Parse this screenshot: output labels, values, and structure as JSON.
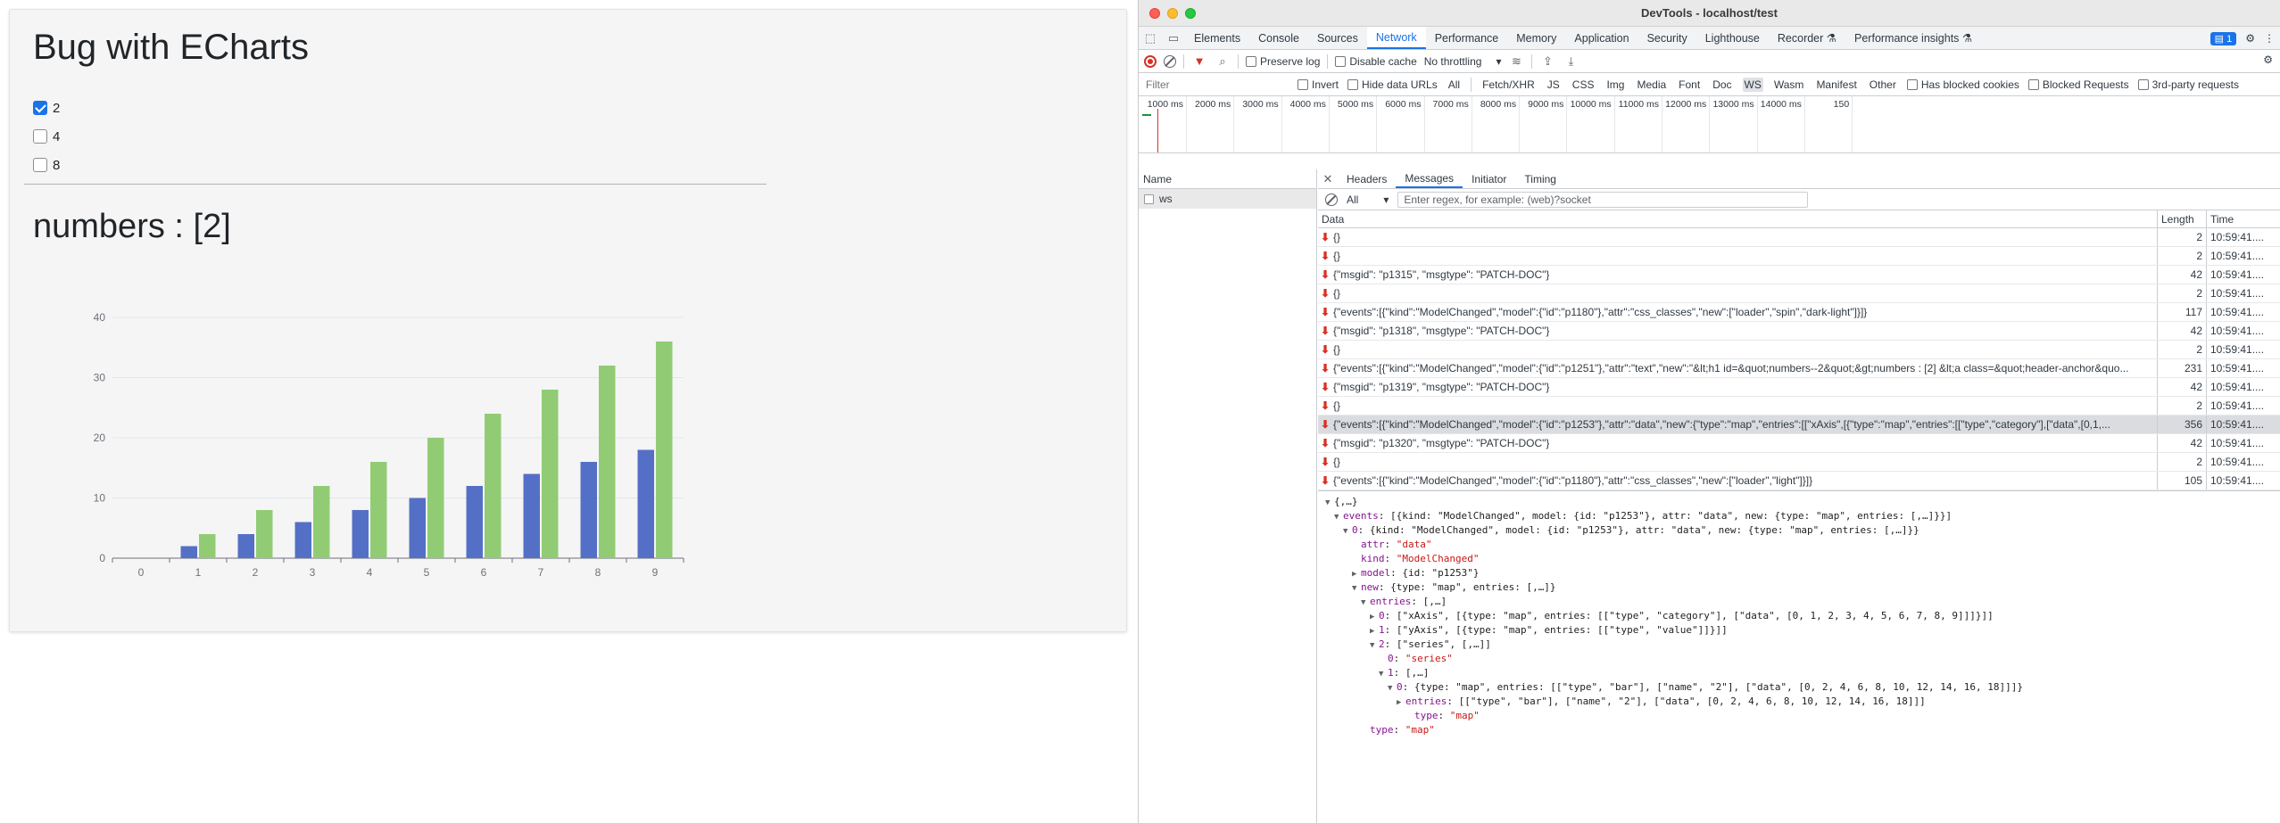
{
  "app": {
    "title": "Bug with ECharts",
    "checkboxes": [
      {
        "label": "2",
        "checked": true
      },
      {
        "label": "4",
        "checked": false
      },
      {
        "label": "8",
        "checked": false
      }
    ],
    "numbers_heading": "numbers : [2]"
  },
  "chart_data": {
    "type": "bar",
    "categories": [
      "0",
      "1",
      "2",
      "3",
      "4",
      "5",
      "6",
      "7",
      "8",
      "9"
    ],
    "series": [
      {
        "values": [
          0,
          2,
          4,
          6,
          8,
          10,
          12,
          14,
          16,
          18
        ],
        "color": "#5470c6"
      },
      {
        "values": [
          0,
          4,
          8,
          12,
          16,
          20,
          24,
          28,
          32,
          36
        ],
        "color": "#91cc75"
      }
    ],
    "yticks": [
      "0",
      "10",
      "20",
      "30",
      "40"
    ],
    "ylim": [
      0,
      40
    ],
    "grid": true
  },
  "devtools": {
    "window_title": "DevTools - localhost/test",
    "tabs": [
      "Elements",
      "Console",
      "Sources",
      "Network",
      "Performance",
      "Memory",
      "Application",
      "Security",
      "Lighthouse",
      "Recorder",
      "Performance insights"
    ],
    "active_tab": "Network",
    "issues_count": "1",
    "toolbar": {
      "preserve_log": "Preserve log",
      "disable_cache": "Disable cache",
      "throttling": "No throttling"
    },
    "filter": {
      "placeholder": "Filter",
      "invert": "Invert",
      "hide_data_urls": "Hide data URLs",
      "types": [
        "All",
        "Fetch/XHR",
        "JS",
        "CSS",
        "Img",
        "Media",
        "Font",
        "Doc",
        "WS",
        "Wasm",
        "Manifest",
        "Other"
      ],
      "active_type": "WS",
      "has_blocked_cookies": "Has blocked cookies",
      "blocked_requests": "Blocked Requests",
      "third_party": "3rd-party requests"
    },
    "overview_labels": [
      "1000 ms",
      "2000 ms",
      "3000 ms",
      "4000 ms",
      "5000 ms",
      "6000 ms",
      "7000 ms",
      "8000 ms",
      "9000 ms",
      "10000 ms",
      "11000 ms",
      "12000 ms",
      "13000 ms",
      "14000 ms",
      "150"
    ],
    "name_header": "Name",
    "request_name": "ws",
    "detail_tabs": [
      "Headers",
      "Messages",
      "Initiator",
      "Timing"
    ],
    "active_detail_tab": "Messages",
    "message_filter": {
      "type": "All",
      "placeholder": "Enter regex, for example: (web)?socket"
    },
    "columns": {
      "data": "Data",
      "length": "Length",
      "time": "Time"
    },
    "messages": [
      {
        "data": "{}",
        "length": "2",
        "time": "10:59:41...."
      },
      {
        "data": "{}",
        "length": "2",
        "time": "10:59:41...."
      },
      {
        "data": "{\"msgid\": \"p1315\", \"msgtype\": \"PATCH-DOC\"}",
        "length": "42",
        "time": "10:59:41...."
      },
      {
        "data": "{}",
        "length": "2",
        "time": "10:59:41...."
      },
      {
        "data": "{\"events\":[{\"kind\":\"ModelChanged\",\"model\":{\"id\":\"p1180\"},\"attr\":\"css_classes\",\"new\":[\"loader\",\"spin\",\"dark-light\"]}]}",
        "length": "117",
        "time": "10:59:41...."
      },
      {
        "data": "{\"msgid\": \"p1318\", \"msgtype\": \"PATCH-DOC\"}",
        "length": "42",
        "time": "10:59:41...."
      },
      {
        "data": "{}",
        "length": "2",
        "time": "10:59:41...."
      },
      {
        "data": "{\"events\":[{\"kind\":\"ModelChanged\",\"model\":{\"id\":\"p1251\"},\"attr\":\"text\",\"new\":\"&lt;h1 id=&quot;numbers--2&quot;&gt;numbers : [2] &lt;a class=&quot;header-anchor&quo...",
        "length": "231",
        "time": "10:59:41...."
      },
      {
        "data": "{\"msgid\": \"p1319\", \"msgtype\": \"PATCH-DOC\"}",
        "length": "42",
        "time": "10:59:41...."
      },
      {
        "data": "{}",
        "length": "2",
        "time": "10:59:41...."
      },
      {
        "data": "{\"events\":[{\"kind\":\"ModelChanged\",\"model\":{\"id\":\"p1253\"},\"attr\":\"data\",\"new\":{\"type\":\"map\",\"entries\":[[\"xAxis\",[{\"type\":\"map\",\"entries\":[[\"type\",\"category\"],[\"data\",[0,1,...",
        "length": "356",
        "time": "10:59:41....",
        "selected": true
      },
      {
        "data": "{\"msgid\": \"p1320\", \"msgtype\": \"PATCH-DOC\"}",
        "length": "42",
        "time": "10:59:41...."
      },
      {
        "data": "{}",
        "length": "2",
        "time": "10:59:41...."
      },
      {
        "data": "{\"events\":[{\"kind\":\"ModelChanged\",\"model\":{\"id\":\"p1180\"},\"attr\":\"css_classes\",\"new\":[\"loader\",\"light\"]}]}",
        "length": "105",
        "time": "10:59:41...."
      }
    ],
    "tree": [
      {
        "tri": "▼",
        "indent": 0,
        "key": "",
        "val": "{,…}"
      },
      {
        "tri": "▼",
        "indent": 1,
        "key": "events",
        "val": "[{kind: \"ModelChanged\", model: {id: \"p1253\"}, attr: \"data\", new: {type: \"map\", entries: [,…]}}]"
      },
      {
        "tri": "▼",
        "indent": 2,
        "key": "0",
        "val": "{kind: \"ModelChanged\", model: {id: \"p1253\"}, attr: \"data\", new: {type: \"map\", entries: [,…]}}"
      },
      {
        "tri": "",
        "indent": 3,
        "key": "attr",
        "val": "\"data\"",
        "str": true
      },
      {
        "tri": "",
        "indent": 3,
        "key": "kind",
        "val": "\"ModelChanged\"",
        "str": true
      },
      {
        "tri": "▶",
        "indent": 3,
        "key": "model",
        "val": "{id: \"p1253\"}"
      },
      {
        "tri": "▼",
        "indent": 3,
        "key": "new",
        "val": "{type: \"map\", entries: [,…]}"
      },
      {
        "tri": "▼",
        "indent": 4,
        "key": "entries",
        "val": "[,…]"
      },
      {
        "tri": "▶",
        "indent": 5,
        "key": "0",
        "val": "[\"xAxis\", [{type: \"map\", entries: [[\"type\", \"category\"], [\"data\", [0, 1, 2, 3, 4, 5, 6, 7, 8, 9]]]}]]"
      },
      {
        "tri": "▶",
        "indent": 5,
        "key": "1",
        "val": "[\"yAxis\", [{type: \"map\", entries: [[\"type\", \"value\"]]}]]"
      },
      {
        "tri": "▼",
        "indent": 5,
        "key": "2",
        "val": "[\"series\", [,…]]"
      },
      {
        "tri": "",
        "indent": 6,
        "key": "0",
        "val": "\"series\"",
        "str": true
      },
      {
        "tri": "▼",
        "indent": 6,
        "key": "1",
        "val": "[,…]"
      },
      {
        "tri": "▼",
        "indent": 7,
        "key": "0",
        "val": "{type: \"map\", entries: [[\"type\", \"bar\"], [\"name\", \"2\"], [\"data\", [0, 2, 4, 6, 8, 10, 12, 14, 16, 18]]]}"
      },
      {
        "tri": "▶",
        "indent": 8,
        "key": "entries",
        "val": "[[\"type\", \"bar\"], [\"name\", \"2\"], [\"data\", [0, 2, 4, 6, 8, 10, 12, 14, 16, 18]]]"
      },
      {
        "tri": "",
        "indent": 9,
        "key": "type",
        "val": "\"map\"",
        "str": true
      },
      {
        "tri": "",
        "indent": 4,
        "key": "type",
        "val": "\"map\"",
        "str": true
      }
    ]
  }
}
